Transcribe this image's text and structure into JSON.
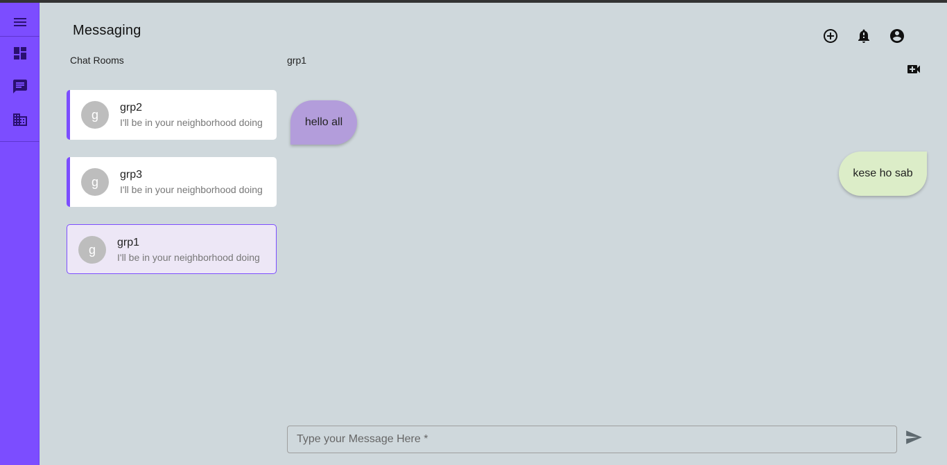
{
  "page": {
    "title": "Messaging"
  },
  "sidebar": {
    "items": [
      {
        "icon": "menu-icon"
      },
      {
        "icon": "dashboard-icon"
      },
      {
        "icon": "chat-icon"
      },
      {
        "icon": "domain-icon"
      }
    ]
  },
  "header": {
    "actions": [
      {
        "icon": "add-circle-icon"
      },
      {
        "icon": "notifications-icon"
      },
      {
        "icon": "account-circle-icon"
      }
    ]
  },
  "chat_rooms": {
    "label": "Chat Rooms",
    "items": [
      {
        "avatar": "g",
        "name": "grp2",
        "preview": "I'll be in your neighborhood doing",
        "active": false
      },
      {
        "avatar": "g",
        "name": "grp3",
        "preview": "I'll be in your neighborhood doing",
        "active": false
      },
      {
        "avatar": "g",
        "name": "grp1",
        "preview": "I'll be in your neighborhood doing",
        "active": true
      }
    ]
  },
  "conversation": {
    "title": "grp1",
    "video_icon": "video-call-icon",
    "messages": [
      {
        "text": "hello all",
        "direction": "incoming"
      },
      {
        "text": "kese ho sab",
        "direction": "outgoing"
      }
    ]
  },
  "composer": {
    "placeholder": "Type your Message Here *",
    "value": "",
    "send_icon": "send-icon"
  },
  "colors": {
    "sidebar": "#7c4dff",
    "background": "#cfd8dc",
    "incoming_bubble": "#b39ddb",
    "outgoing_bubble": "#dcedc8",
    "active_room": "#ede7f6"
  }
}
